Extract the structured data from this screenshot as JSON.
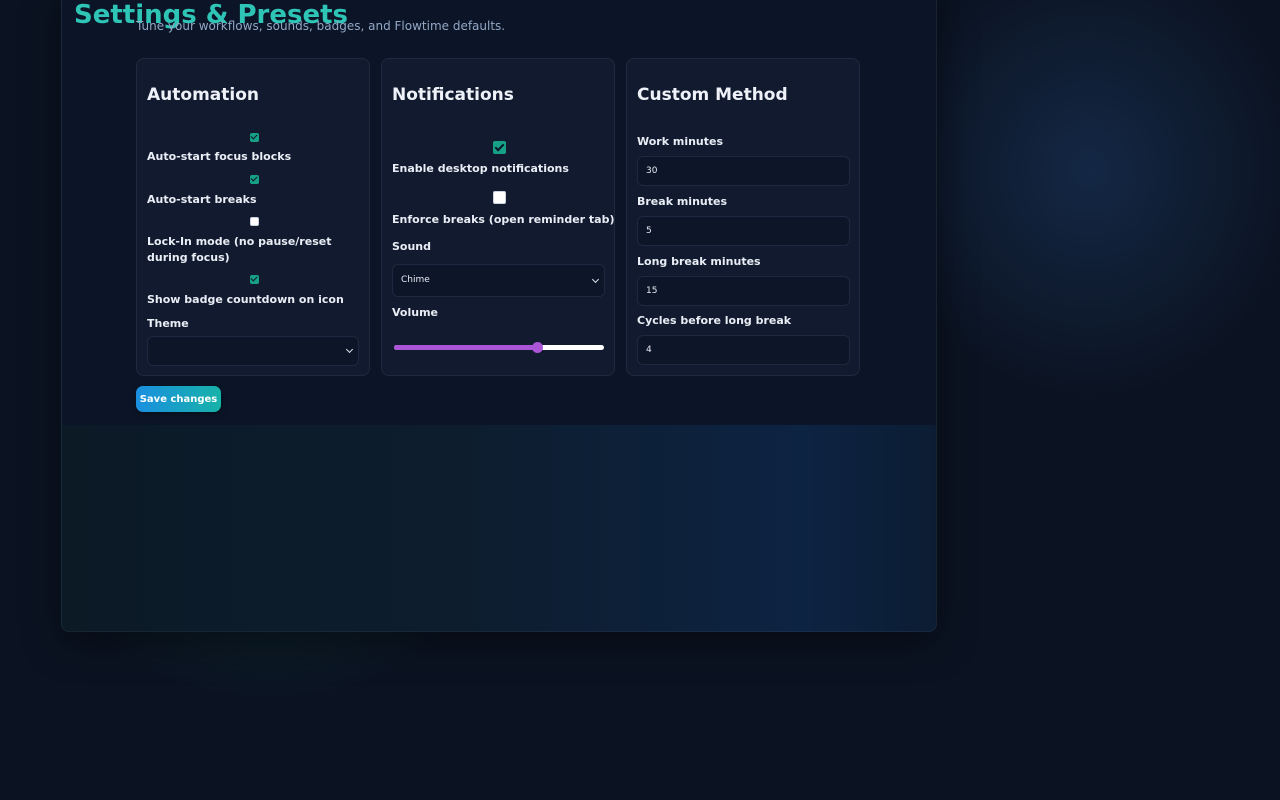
{
  "header": {
    "title": "Settings & Presets",
    "subtitle": "Tune your workflows, sounds, badges, and Flowtime defaults."
  },
  "automation": {
    "title": "Automation",
    "options": [
      {
        "label": "Auto-start focus blocks",
        "checked": true
      },
      {
        "label": "Auto-start breaks",
        "checked": true
      },
      {
        "label": "Lock-In mode (no pause/reset during focus)",
        "checked": false
      },
      {
        "label": "Show badge countdown on icon",
        "checked": true
      }
    ],
    "theme_label": "Theme",
    "theme_value": ""
  },
  "notifications": {
    "title": "Notifications",
    "desktop_label": "Enable desktop notifications",
    "desktop_checked": true,
    "enforce_label": "Enforce breaks (open reminder tab)",
    "enforce_checked": false,
    "sound_label": "Sound",
    "sound_value": "Chime",
    "volume_label": "Volume",
    "volume_fraction": 0.68
  },
  "custom_method": {
    "title": "Custom Method",
    "fields": [
      {
        "label": "Work minutes",
        "value": "30"
      },
      {
        "label": "Break minutes",
        "value": "5"
      },
      {
        "label": "Long break minutes",
        "value": "15"
      },
      {
        "label": "Cycles before long break",
        "value": "4"
      }
    ]
  },
  "actions": {
    "save_label": "Save changes"
  },
  "colors": {
    "accent_teal": "#16a085",
    "slider_purple": "#a955d6",
    "button_start": "#1a8fe0",
    "button_end": "#17b2a8"
  }
}
